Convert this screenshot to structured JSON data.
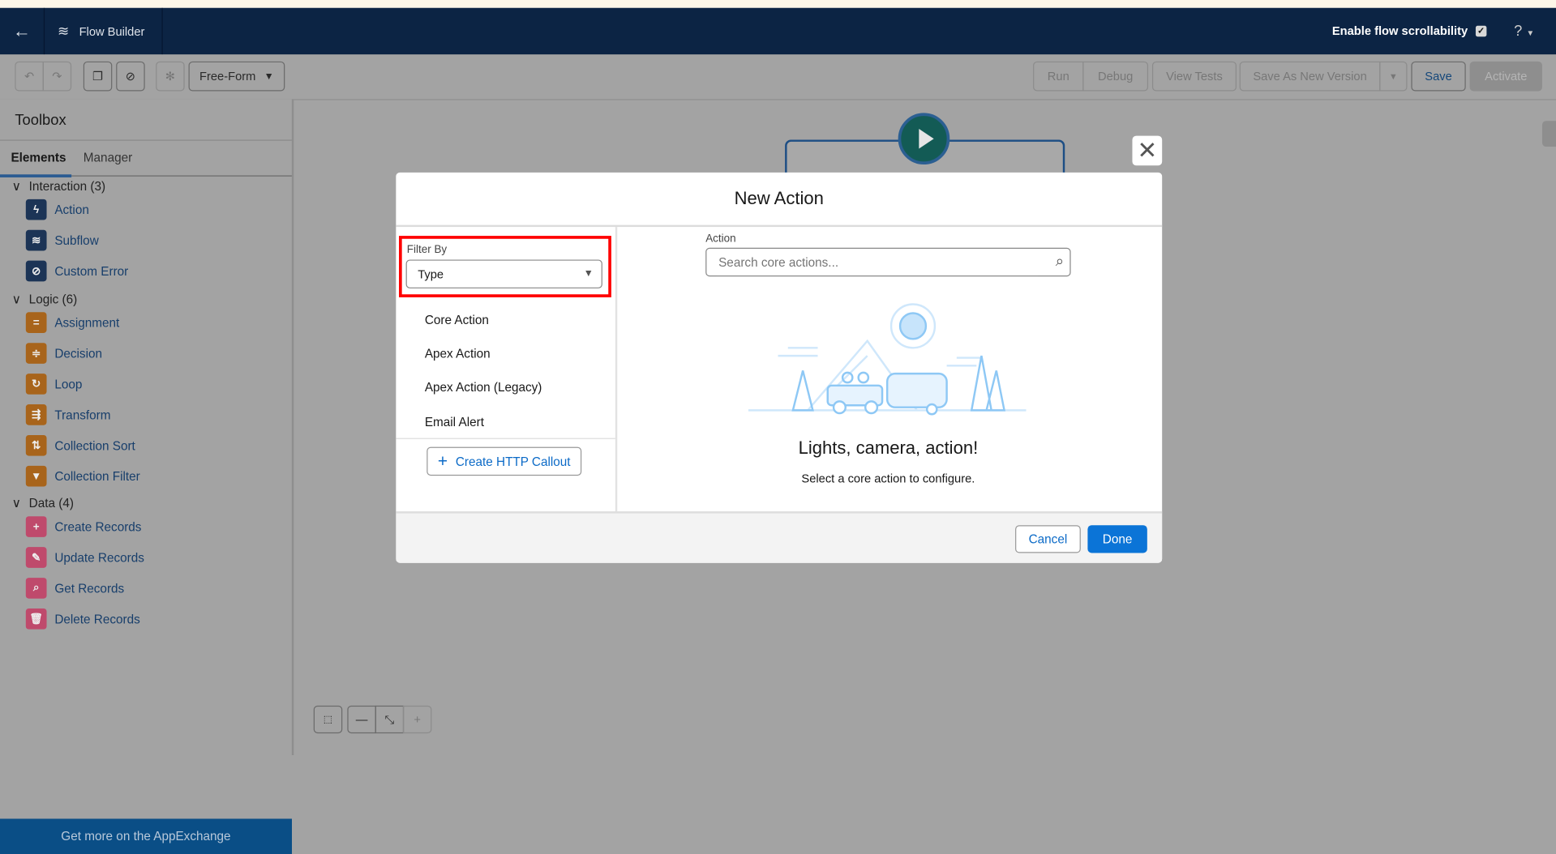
{
  "header": {
    "app_title": "Flow Builder",
    "scroll_label": "Enable flow scrollability",
    "scroll_checked": true,
    "help": "?"
  },
  "toolbar": {
    "layout_mode": "Free-Form",
    "run": "Run",
    "debug": "Debug",
    "view_tests": "View Tests",
    "save_as": "Save As New Version",
    "save": "Save",
    "activate": "Activate"
  },
  "sidebar": {
    "title": "Toolbox",
    "tabs": [
      "Elements",
      "Manager"
    ],
    "sections": [
      {
        "label": "Interaction (3)",
        "items": [
          {
            "label": "Action",
            "icon": "lightning-icon",
            "color": "#1c3456"
          },
          {
            "label": "Subflow",
            "icon": "flow-icon",
            "color": "#1c3456"
          },
          {
            "label": "Custom Error",
            "icon": "ban-icon",
            "color": "#1c3456"
          }
        ]
      },
      {
        "label": "Logic (6)",
        "items": [
          {
            "label": "Assignment",
            "icon": "equals-icon",
            "color": "#a8641b"
          },
          {
            "label": "Decision",
            "icon": "decision-icon",
            "color": "#a8641b"
          },
          {
            "label": "Loop",
            "icon": "loop-icon",
            "color": "#a8641b"
          },
          {
            "label": "Transform",
            "icon": "transform-icon",
            "color": "#a8641b"
          },
          {
            "label": "Collection Sort",
            "icon": "sort-icon",
            "color": "#a8641b"
          },
          {
            "label": "Collection Filter",
            "icon": "filter-icon",
            "color": "#a8641b"
          }
        ]
      },
      {
        "label": "Data (4)",
        "items": [
          {
            "label": "Create Records",
            "icon": "record-create-icon",
            "color": "#bf4a6c"
          },
          {
            "label": "Update Records",
            "icon": "record-update-icon",
            "color": "#bf4a6c"
          },
          {
            "label": "Get Records",
            "icon": "record-lookup-icon",
            "color": "#bf4a6c"
          },
          {
            "label": "Delete Records",
            "icon": "record-delete-icon",
            "color": "#bf4a6c"
          }
        ]
      }
    ],
    "appexchange": "Get more on the AppExchange"
  },
  "modal": {
    "title": "New Action",
    "filter_label": "Filter By",
    "filter_value": "Type",
    "types": [
      "Core Action",
      "Apex Action",
      "Apex Action (Legacy)",
      "Email Alert"
    ],
    "http_callout": "Create HTTP Callout",
    "action_label": "Action",
    "search_placeholder": "Search core actions...",
    "empty_title": "Lights, camera, action!",
    "empty_sub": "Select a core action to configure.",
    "cancel": "Cancel",
    "done": "Done"
  }
}
